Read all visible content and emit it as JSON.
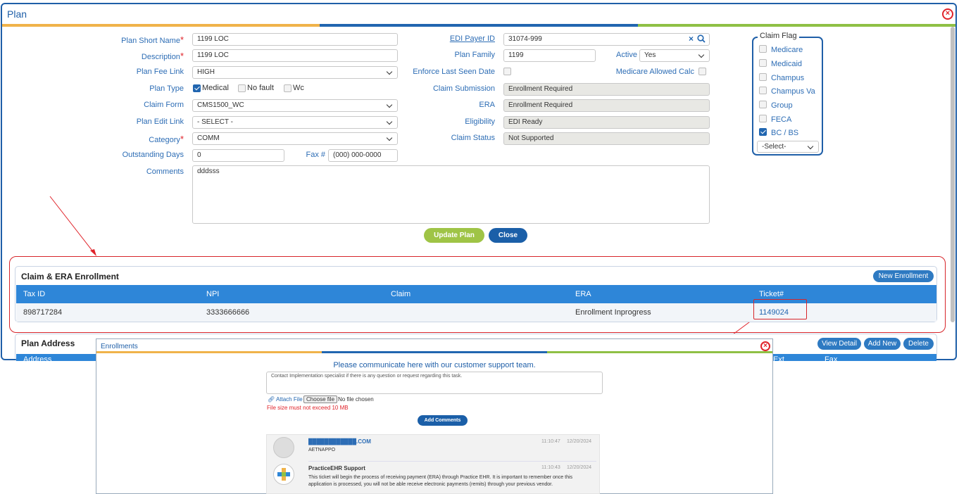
{
  "window": {
    "title": "Plan"
  },
  "form": {
    "plan_short_name": {
      "label": "Plan Short Name",
      "value": "1199 LOC"
    },
    "description": {
      "label": "Description",
      "value": "1199 LOC"
    },
    "plan_fee_link": {
      "label": "Plan Fee Link",
      "value": "HIGH"
    },
    "plan_type": {
      "label": "Plan Type",
      "options": [
        "Medical",
        "No fault",
        "Wc"
      ]
    },
    "claim_form": {
      "label": "Claim Form",
      "value": "CMS1500_WC"
    },
    "plan_edit_link": {
      "label": "Plan Edit Link",
      "value": "- SELECT -"
    },
    "category": {
      "label": "Category",
      "value": "COMM"
    },
    "outstanding_days": {
      "label": "Outstanding Days",
      "value": "0"
    },
    "fax": {
      "label": "Fax #",
      "value": "(000) 000-0000"
    },
    "comments": {
      "label": "Comments",
      "value": "dddsss"
    },
    "edi_payer_id": {
      "label": "EDI Payer ID",
      "value": "31074-999"
    },
    "plan_family": {
      "label": "Plan Family",
      "value": "1199"
    },
    "active": {
      "label": "Active",
      "value": "Yes"
    },
    "enforce_last_seen": {
      "label": "Enforce Last Seen Date"
    },
    "medicare_allowed_calc": {
      "label": "Medicare Allowed Calc"
    },
    "claim_submission": {
      "label": "Claim Submission",
      "value": "Enrollment Required"
    },
    "era": {
      "label": "ERA",
      "value": "Enrollment Required"
    },
    "eligibility": {
      "label": "Eligibility",
      "value": "EDI Ready"
    },
    "claim_status": {
      "label": "Claim Status",
      "value": "Not Supported"
    }
  },
  "claim_flag": {
    "legend": "Claim Flag",
    "items": [
      "Medicare",
      "Medicaid",
      "Champus",
      "Champus Va",
      "Group",
      "FECA",
      "BC / BS"
    ],
    "checked": "BC / BS",
    "select": "-Select-"
  },
  "buttons": {
    "update": "Update Plan",
    "close": "Close"
  },
  "enrollment": {
    "title": "Claim & ERA Enrollment",
    "new_button": "New Enrollment",
    "columns": [
      "Tax ID",
      "NPI",
      "Claim",
      "ERA",
      "Ticket#"
    ],
    "rows": [
      {
        "tax_id": "898717284",
        "npi": "3333666666",
        "claim": "",
        "era": "Enrollment Inprogress",
        "ticket": "1149024"
      }
    ]
  },
  "plan_address": {
    "title": "Plan Address",
    "buttons": [
      "View Detail",
      "Add New",
      "Delete"
    ],
    "partial_headers": [
      "Address",
      "Ext",
      "Fax"
    ]
  },
  "modal": {
    "title": "Enrollments",
    "heading": "Please communicate here with our customer support team.",
    "placeholder": "Contact Implementation specialist if there is any question or request regarding this task.",
    "attach_label": "Attach File",
    "choose_file": "Choose file",
    "no_file": "No file chosen",
    "size_note": "File size must not exceed 10 MB",
    "add_button": "Add Comments",
    "comments": [
      {
        "author": "████████████.COM",
        "sub": "AETNAPPO",
        "time": "11:10:47",
        "date": "12/20/2024",
        "body": ""
      },
      {
        "author": "PracticeEHR Support",
        "sub": "",
        "time": "11:10:43",
        "date": "12/20/2024",
        "body": "This ticket will begin the process of receiving payment (ERA) through Practice EHR. It is important to remember once this application is processed, you will not be able receive electronic payments (remits) through your previous vendor."
      }
    ]
  },
  "colors": {
    "brand_blue": "#1f5fa8",
    "green": "#8fc045",
    "orange": "#f0b34a",
    "red": "#e0232a"
  }
}
